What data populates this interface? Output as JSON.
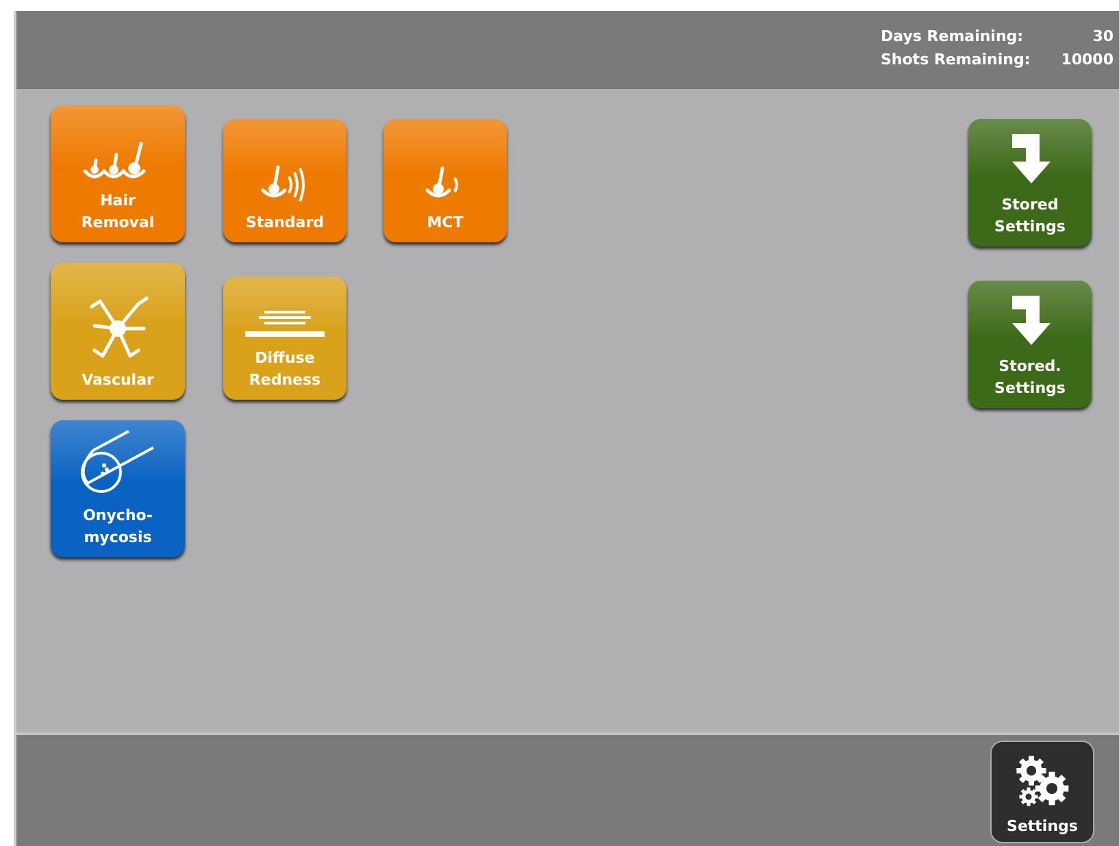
{
  "header": {
    "stats": [
      {
        "label": "Days Remaining:",
        "value": "30"
      },
      {
        "label": "Shots Remaining:",
        "value": "10000"
      }
    ]
  },
  "treatment_rows": [
    [
      {
        "label": "Hair\nRemoval",
        "kind": "hairs",
        "color": "#ef7a00"
      },
      {
        "label": "Standard",
        "kind": "wave",
        "color": "#ef7a00"
      },
      {
        "label": "MCT",
        "kind": "pulse",
        "color": "#ef7a00"
      }
    ],
    [
      {
        "label": "Vascular",
        "kind": "vessel",
        "color": "#d9a21a"
      },
      {
        "label": "Diffuse\nRedness",
        "kind": "skin",
        "color": "#d9a21a"
      }
    ],
    [
      {
        "label": "Onycho-\nmycosis",
        "kind": "nail",
        "color": "#0a63c2"
      }
    ]
  ],
  "stored_settings": [
    {
      "label": "Stored\nSettings"
    },
    {
      "label": "Stored.\nSettings"
    }
  ],
  "footer": {
    "settings_button": {
      "label": "Settings"
    }
  }
}
